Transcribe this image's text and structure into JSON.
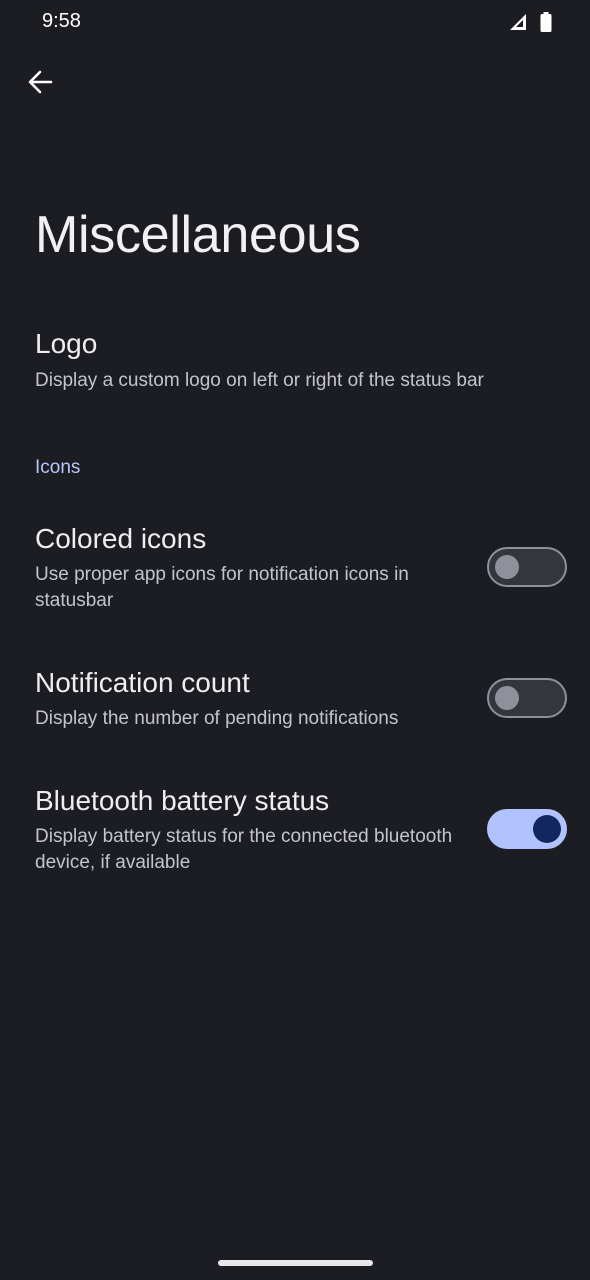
{
  "status_bar": {
    "time": "9:58",
    "icons": [
      "signal-icon",
      "battery-icon"
    ]
  },
  "toolbar": {
    "back_icon": "arrow-back-icon"
  },
  "page": {
    "title": "Miscellaneous"
  },
  "preferences": {
    "logo": {
      "title": "Logo",
      "summary": "Display a custom logo on left or right of the status bar"
    },
    "icons_category": "Icons",
    "colored_icons": {
      "title": "Colored icons",
      "summary": "Use proper app icons for notification icons in statusbar",
      "enabled": false
    },
    "notification_count": {
      "title": "Notification count",
      "summary": "Display the number of pending notifications",
      "enabled": false
    },
    "bluetooth_battery": {
      "title": "Bluetooth battery status",
      "summary": "Display battery status for the connected bluetooth device, if available",
      "enabled": true
    }
  },
  "colors": {
    "background": "#1c1d22",
    "accent": "#b8c6ff",
    "switch_on_track": "#b2c2ff",
    "switch_on_thumb": "#13275f",
    "switch_off_outline": "#8f9099"
  }
}
